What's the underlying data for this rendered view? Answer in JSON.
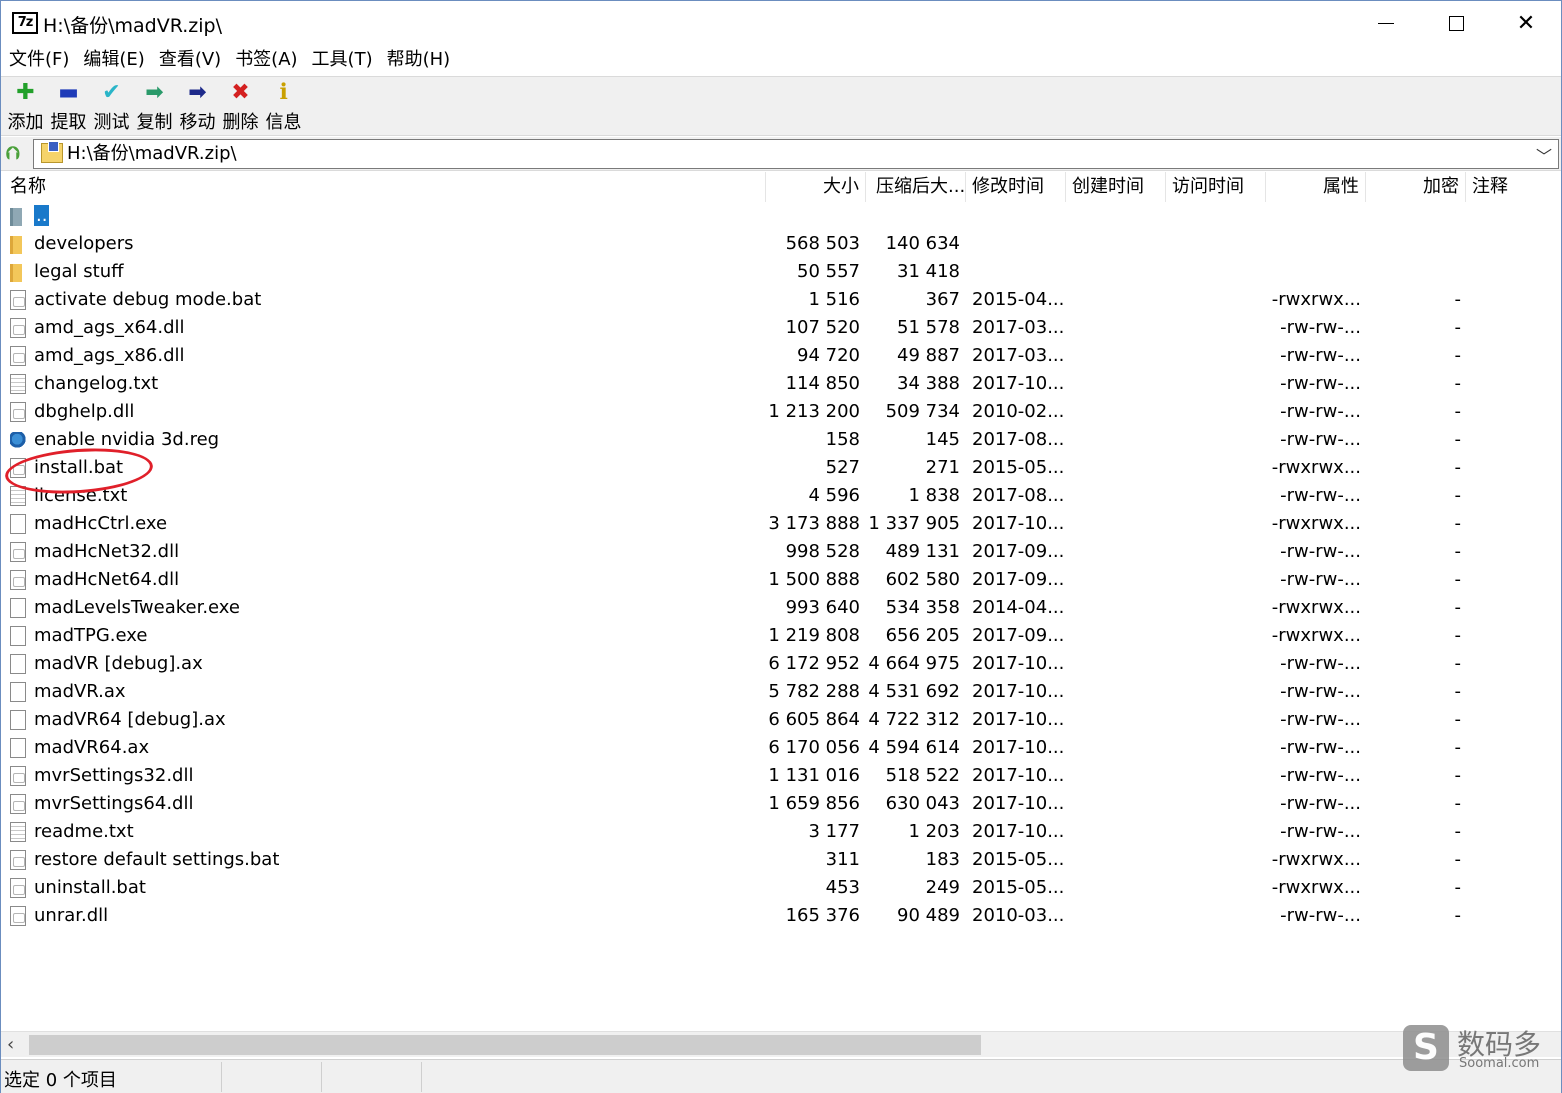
{
  "window": {
    "title": "H:\\备份\\madVR.zip\\",
    "app_icon_text": "7z"
  },
  "menu": [
    "文件(F)",
    "编辑(E)",
    "查看(V)",
    "书签(A)",
    "工具(T)",
    "帮助(H)"
  ],
  "toolbar": [
    {
      "label": "添加",
      "icon": "add-icon",
      "glyph": "✚",
      "color": "#22a02a"
    },
    {
      "label": "提取",
      "icon": "extract-icon",
      "glyph": "▬",
      "color": "#1e3bb8"
    },
    {
      "label": "测试",
      "icon": "test-icon",
      "glyph": "✔",
      "color": "#2ab5c8"
    },
    {
      "label": "复制",
      "icon": "copy-icon",
      "glyph": "➡",
      "color": "#2a9a6a"
    },
    {
      "label": "移动",
      "icon": "move-icon",
      "glyph": "➡",
      "color": "#1e2a8a"
    },
    {
      "label": "删除",
      "icon": "delete-icon",
      "glyph": "✖",
      "color": "#d42020"
    },
    {
      "label": "信息",
      "icon": "info-icon",
      "glyph": "ℹ",
      "color": "#c9a000"
    }
  ],
  "address": {
    "value": "H:\\备份\\madVR.zip\\"
  },
  "columns": {
    "name": "名称",
    "size": "大小",
    "packed": "压缩后大...",
    "modified": "修改时间",
    "created": "创建时间",
    "accessed": "访问时间",
    "attributes": "属性",
    "encrypted": "加密",
    "comment": "注释"
  },
  "files": [
    {
      "name": "..",
      "type": "up",
      "size": "",
      "packed": "",
      "modified": "",
      "attr": "",
      "enc": ""
    },
    {
      "name": "developers",
      "type": "folder",
      "size": "568 503",
      "packed": "140 634",
      "modified": "",
      "attr": "",
      "enc": ""
    },
    {
      "name": "legal stuff",
      "type": "folder",
      "size": "50 557",
      "packed": "31 418",
      "modified": "",
      "attr": "",
      "enc": ""
    },
    {
      "name": "activate debug mode.bat",
      "type": "file",
      "size": "1 516",
      "packed": "367",
      "modified": "2015-04...",
      "attr": "-rwxrwx...",
      "enc": "-"
    },
    {
      "name": "amd_ags_x64.dll",
      "type": "file",
      "size": "107 520",
      "packed": "51 578",
      "modified": "2017-03...",
      "attr": "-rw-rw-...",
      "enc": "-"
    },
    {
      "name": "amd_ags_x86.dll",
      "type": "file",
      "size": "94 720",
      "packed": "49 887",
      "modified": "2017-03...",
      "attr": "-rw-rw-...",
      "enc": "-"
    },
    {
      "name": "changelog.txt",
      "type": "text",
      "size": "114 850",
      "packed": "34 388",
      "modified": "2017-10...",
      "attr": "-rw-rw-...",
      "enc": "-"
    },
    {
      "name": "dbghelp.dll",
      "type": "file",
      "size": "1 213 200",
      "packed": "509 734",
      "modified": "2010-02...",
      "attr": "-rw-rw-...",
      "enc": "-"
    },
    {
      "name": "enable nvidia 3d.reg",
      "type": "reg",
      "size": "158",
      "packed": "145",
      "modified": "2017-08...",
      "attr": "-rw-rw-...",
      "enc": "-"
    },
    {
      "name": "install.bat",
      "type": "file",
      "size": "527",
      "packed": "271",
      "modified": "2015-05...",
      "attr": "-rwxrwx...",
      "enc": "-"
    },
    {
      "name": "license.txt",
      "type": "text",
      "size": "4 596",
      "packed": "1 838",
      "modified": "2017-08...",
      "attr": "-rw-rw-...",
      "enc": "-"
    },
    {
      "name": "madHcCtrl.exe",
      "type": "exe",
      "size": "3 173 888",
      "packed": "1 337 905",
      "modified": "2017-10...",
      "attr": "-rwxrwx...",
      "enc": "-"
    },
    {
      "name": "madHcNet32.dll",
      "type": "file",
      "size": "998 528",
      "packed": "489 131",
      "modified": "2017-09...",
      "attr": "-rw-rw-...",
      "enc": "-"
    },
    {
      "name": "madHcNet64.dll",
      "type": "file",
      "size": "1 500 888",
      "packed": "602 580",
      "modified": "2017-09...",
      "attr": "-rw-rw-...",
      "enc": "-"
    },
    {
      "name": "madLevelsTweaker.exe",
      "type": "exe",
      "size": "993 640",
      "packed": "534 358",
      "modified": "2014-04...",
      "attr": "-rwxrwx...",
      "enc": "-"
    },
    {
      "name": "madTPG.exe",
      "type": "exe",
      "size": "1 219 808",
      "packed": "656 205",
      "modified": "2017-09...",
      "attr": "-rwxrwx...",
      "enc": "-"
    },
    {
      "name": "madVR [debug].ax",
      "type": "exe",
      "size": "6 172 952",
      "packed": "4 664 975",
      "modified": "2017-10...",
      "attr": "-rw-rw-...",
      "enc": "-"
    },
    {
      "name": "madVR.ax",
      "type": "exe",
      "size": "5 782 288",
      "packed": "4 531 692",
      "modified": "2017-10...",
      "attr": "-rw-rw-...",
      "enc": "-"
    },
    {
      "name": "madVR64 [debug].ax",
      "type": "exe",
      "size": "6 605 864",
      "packed": "4 722 312",
      "modified": "2017-10...",
      "attr": "-rw-rw-...",
      "enc": "-"
    },
    {
      "name": "madVR64.ax",
      "type": "exe",
      "size": "6 170 056",
      "packed": "4 594 614",
      "modified": "2017-10...",
      "attr": "-rw-rw-...",
      "enc": "-"
    },
    {
      "name": "mvrSettings32.dll",
      "type": "file",
      "size": "1 131 016",
      "packed": "518 522",
      "modified": "2017-10...",
      "attr": "-rw-rw-...",
      "enc": "-"
    },
    {
      "name": "mvrSettings64.dll",
      "type": "file",
      "size": "1 659 856",
      "packed": "630 043",
      "modified": "2017-10...",
      "attr": "-rw-rw-...",
      "enc": "-"
    },
    {
      "name": "readme.txt",
      "type": "text",
      "size": "3 177",
      "packed": "1 203",
      "modified": "2017-10...",
      "attr": "-rw-rw-...",
      "enc": "-"
    },
    {
      "name": "restore default settings.bat",
      "type": "file",
      "size": "311",
      "packed": "183",
      "modified": "2015-05...",
      "attr": "-rwxrwx...",
      "enc": "-"
    },
    {
      "name": "uninstall.bat",
      "type": "file",
      "size": "453",
      "packed": "249",
      "modified": "2015-05...",
      "attr": "-rwxrwx...",
      "enc": "-"
    },
    {
      "name": "unrar.dll",
      "type": "file",
      "size": "165 376",
      "packed": "90 489",
      "modified": "2010-03...",
      "attr": "-rw-rw-...",
      "enc": "-"
    }
  ],
  "status": {
    "text": "选定 0 个项目"
  },
  "watermark": {
    "logo_glyph": "S",
    "cn": "数码多",
    "en": "Soomal.com"
  }
}
